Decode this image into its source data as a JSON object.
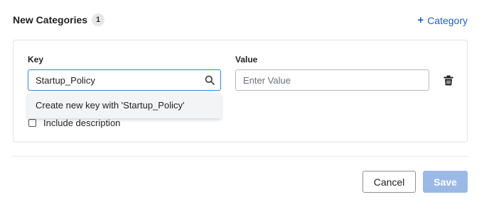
{
  "header": {
    "title": "New Categories",
    "count": "1",
    "add_label": "Category",
    "add_icon": "plus-icon"
  },
  "form": {
    "key_label": "Key",
    "value_label": "Value",
    "key_value": "Startup_Policy",
    "value_placeholder": "Enter Value",
    "dropdown_option": "Create new key with 'Startup_Policy'",
    "description_label": "Include description",
    "description_checked": false
  },
  "footer": {
    "cancel_label": "Cancel",
    "save_label": "Save"
  },
  "colors": {
    "accent": "#1f5fbf",
    "focus_border": "#3d7fd8",
    "save_disabled": "#9bb9e6"
  }
}
